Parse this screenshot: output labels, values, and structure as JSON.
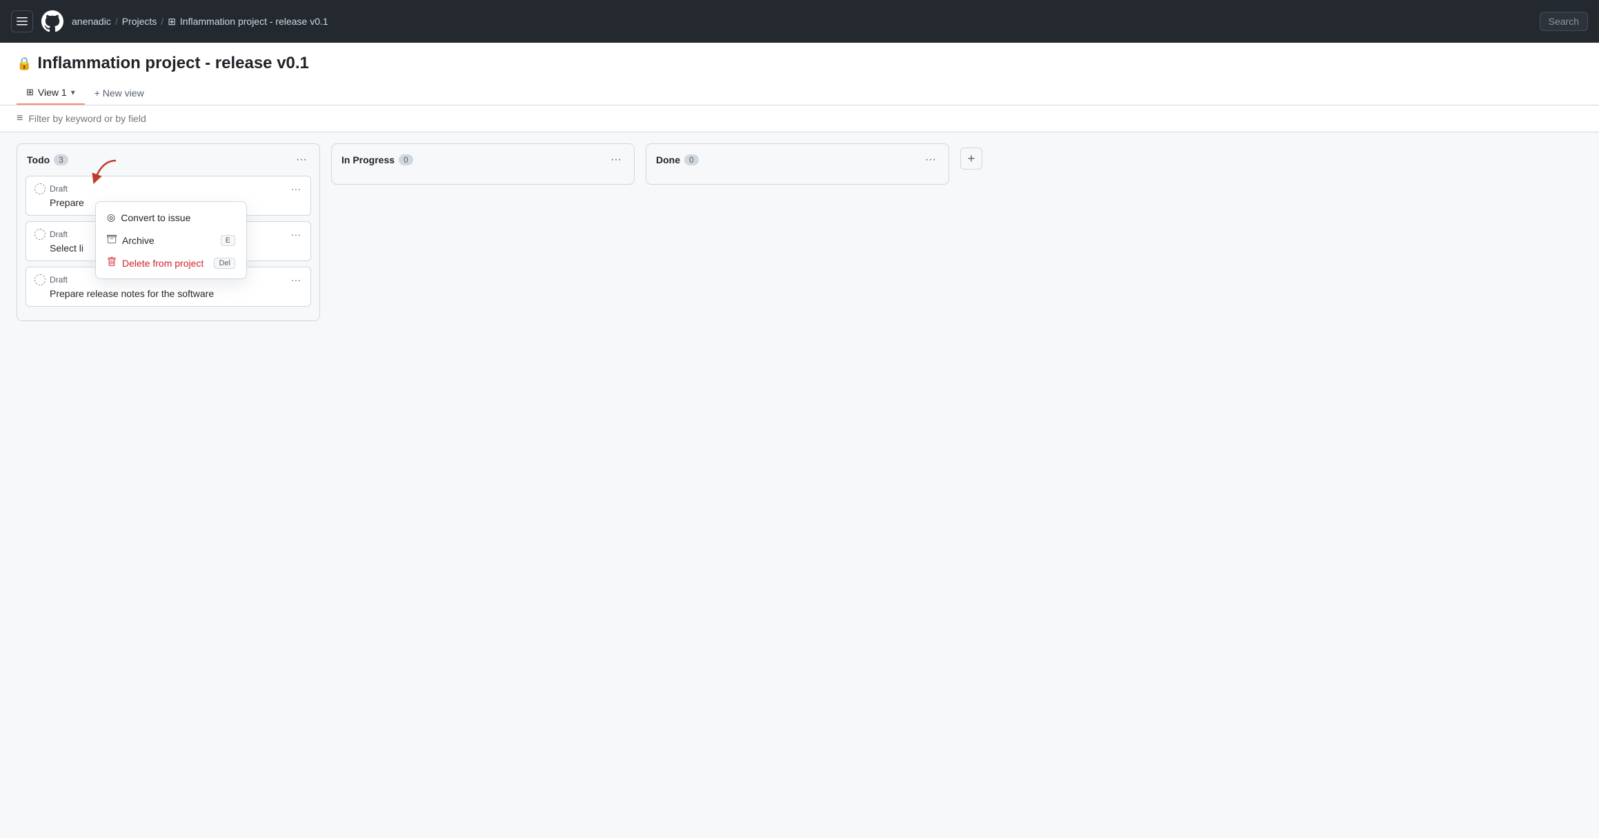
{
  "navbar": {
    "hamburger_label": "☰",
    "user": "anenadic",
    "sep1": "/",
    "projects": "Projects",
    "sep2": "/",
    "project_title": "Inflammation project - release v0.1",
    "search_label": "Search"
  },
  "page": {
    "lock_icon": "🔒",
    "title": "Inflammation project - release v0.1"
  },
  "tabs": [
    {
      "label": "View 1",
      "icon": "⊞",
      "active": true
    }
  ],
  "new_view": "+ New view",
  "filter": {
    "placeholder": "Filter by keyword or by field"
  },
  "columns": [
    {
      "id": "todo",
      "title": "Todo",
      "count": "3",
      "cards": [
        {
          "id": "card1",
          "badge": "Draft",
          "text": "Prepare"
        },
        {
          "id": "card2",
          "badge": "Draft",
          "text": "Select li"
        },
        {
          "id": "card3",
          "badge": "Draft",
          "text": "Prepare release notes for the software"
        }
      ]
    },
    {
      "id": "in-progress",
      "title": "In Progress",
      "count": "0",
      "cards": []
    },
    {
      "id": "done",
      "title": "Done",
      "count": "0",
      "cards": []
    }
  ],
  "context_menu": {
    "items": [
      {
        "id": "convert",
        "icon": "◎",
        "label": "Convert to issue",
        "shortcut": "",
        "danger": false
      },
      {
        "id": "archive",
        "icon": "🗄",
        "label": "Archive",
        "shortcut": "E",
        "danger": false
      },
      {
        "id": "delete",
        "icon": "🗑",
        "label": "Delete from project",
        "shortcut": "Del",
        "danger": true
      }
    ]
  }
}
